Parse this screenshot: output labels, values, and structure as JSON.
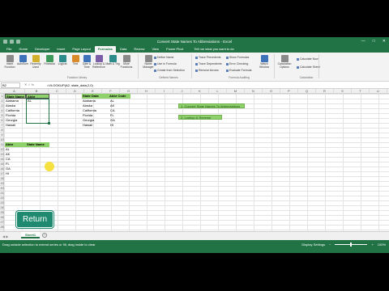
{
  "window": {
    "title": "Convert State Names To Abbreviations - Excel",
    "controls": [
      "—",
      "□",
      "✕"
    ]
  },
  "ribbon_tabs": [
    "File",
    "Home",
    "Developer",
    "Insert",
    "Page Layout",
    "Formulas",
    "Data",
    "Review",
    "View",
    "Power Pivot"
  ],
  "active_tab": "Formulas",
  "tell_me": "Tell me what you want to do",
  "ribbon": {
    "buttons": [
      {
        "label": "Insert Function",
        "color": "gray"
      },
      {
        "label": "AutoSum",
        "color": "blue"
      },
      {
        "label": "Recently Used",
        "color": "yellow"
      },
      {
        "label": "Financial",
        "color": "green"
      },
      {
        "label": "Logical",
        "color": "teal"
      },
      {
        "label": "Text",
        "color": "orange"
      },
      {
        "label": "Date & Time",
        "color": "blue"
      },
      {
        "label": "Lookup & Reference",
        "color": "purple"
      },
      {
        "label": "Math & Trig",
        "color": "teal"
      },
      {
        "label": "More Functions",
        "color": "gray"
      },
      {
        "label": "Name Manager",
        "color": "gray"
      },
      {
        "label": "Watch Window",
        "color": "blue"
      },
      {
        "label": "Calculation Options",
        "color": "gray"
      }
    ],
    "defined_names": [
      "Define Name",
      "Use in Formula",
      "Create from Selection"
    ],
    "auditing": [
      "Trace Precedents",
      "Trace Dependents",
      "Remove Arrows",
      "Show Formulas",
      "Error Checking",
      "Evaluate Formula"
    ],
    "calc": [
      "Calculate Now",
      "Calculate Sheet"
    ],
    "groups": [
      "Function Library",
      "Defined Names",
      "Formula Auditing",
      "Calculation"
    ]
  },
  "formula_bar": {
    "name_box": "B2",
    "symbols": "✕  ✓  fx",
    "formula": "=VLOOKUP(A2, state_data,2,0)"
  },
  "columns": [
    "A",
    "B",
    "C",
    "D",
    "E",
    "F",
    "G",
    "H",
    "I",
    "J",
    "K",
    "L",
    "M",
    "N",
    "O",
    "P",
    "Q",
    "R",
    "S",
    "T",
    "U",
    "V"
  ],
  "rows": [
    "1",
    "2",
    "3",
    "4",
    "5",
    "6",
    "7",
    "8",
    "9",
    "10",
    "11",
    "12",
    "13",
    "14",
    "15",
    "16",
    "17",
    "18",
    "19",
    "20",
    "21",
    "22",
    "23",
    "24",
    "25",
    "26",
    "27",
    "28"
  ],
  "table1": {
    "headers": [
      "State Name",
      "Abbr"
    ],
    "names": [
      "Alabama",
      "Alaska",
      "California",
      "Florida",
      "Georgia",
      "Hawaii"
    ],
    "abbr_first": "AL"
  },
  "table2": {
    "headers": [
      "State Data",
      "Abbr Code"
    ],
    "rows": [
      [
        "Alabama",
        "AL"
      ],
      [
        "Alaska",
        "AK"
      ],
      [
        "California",
        "CA"
      ],
      [
        "Florida",
        "FL"
      ],
      [
        "Georgia",
        "GA"
      ],
      [
        "Hawaii",
        "HI"
      ]
    ]
  },
  "table3": {
    "headers": [
      "Abbr",
      "State Name"
    ],
    "codes": [
      "AL",
      "AK",
      "CA",
      "FL",
      "GA",
      "HI"
    ]
  },
  "action_buttons": [
    "1. Convert State Names To Abbreviations",
    "2. Lookup & Reverse"
  ],
  "return_button": "Return",
  "sheet_tab": "Sheet1",
  "status": {
    "message": "Drag outside selection to extend series or fill; drag inside to clear",
    "display_settings": "Display Settings",
    "zoom": "100%"
  },
  "accent_color": "#217346",
  "header_fill": "#8fd16a"
}
